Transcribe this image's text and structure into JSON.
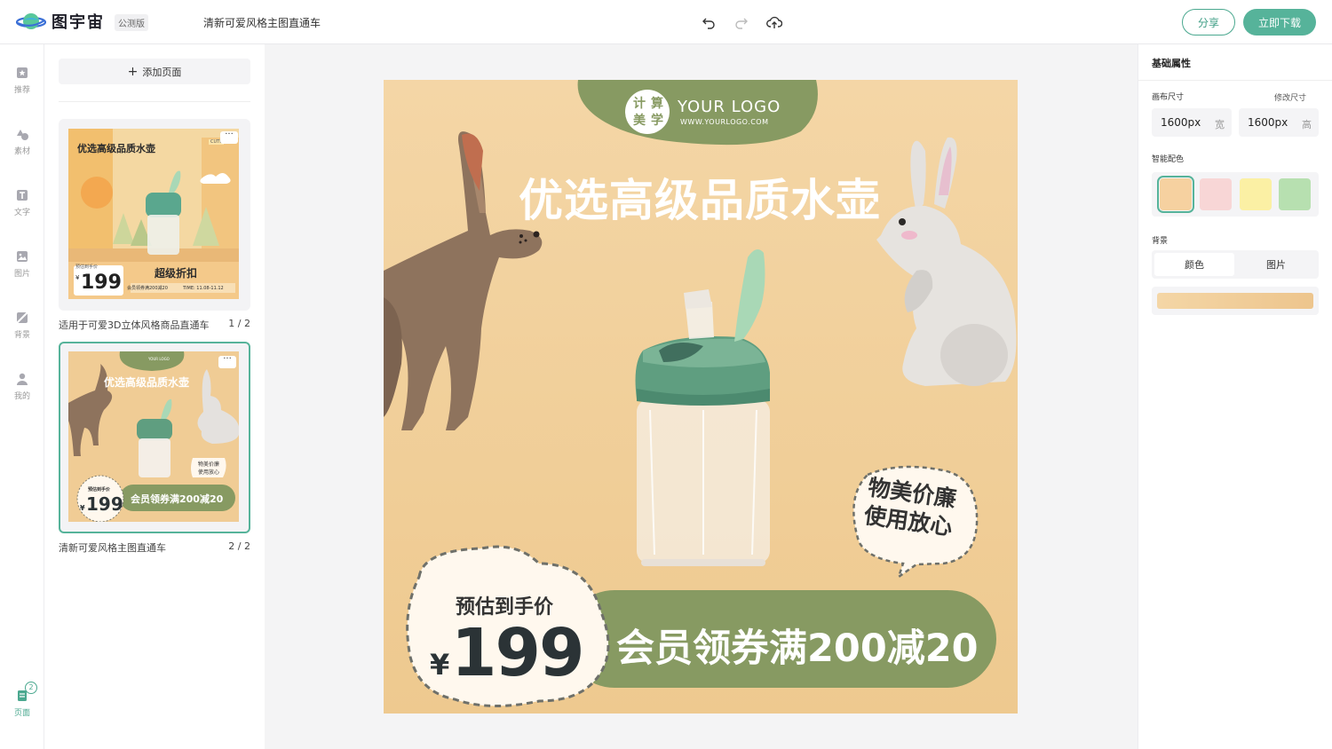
{
  "app": {
    "name": "图宇宙",
    "beta_badge": "公测版"
  },
  "header": {
    "doc_title": "清新可爱风格主图直通车",
    "share_label": "分享",
    "download_label": "立即下载"
  },
  "rail": {
    "items": [
      {
        "label": "推荐",
        "icon": "recommend-icon"
      },
      {
        "label": "素材",
        "icon": "shapes-icon"
      },
      {
        "label": "文字",
        "icon": "text-icon"
      },
      {
        "label": "图片",
        "icon": "image-icon"
      },
      {
        "label": "背景",
        "icon": "background-icon"
      },
      {
        "label": "我的",
        "icon": "user-icon"
      }
    ],
    "pages": {
      "label": "页面",
      "count": "2"
    }
  },
  "pages_panel": {
    "add_page_label": "添加页面",
    "pages": [
      {
        "caption": "适用于可爱3D立体风格商品直通车",
        "index": "1 / 2",
        "thumb": {
          "title": "优选高级品质水壶",
          "tag": "CUTE",
          "pre_label": "预估到手价",
          "currency": "¥",
          "price": "199",
          "promo": "超级折扣",
          "coupon": "会员领券满200减20",
          "time": "TIME: 11.08-11.12"
        }
      },
      {
        "caption": "清新可爱风格主图直通车",
        "index": "2 / 2",
        "thumb": {
          "logo": "YOUR LOGO",
          "title": "优选高级品质水壶",
          "bubble_1": "物美价廉",
          "bubble_2": "使用放心",
          "pre_label": "预估到手价",
          "currency": "¥",
          "price": "199",
          "coupon": "会员领券满200减20"
        }
      }
    ]
  },
  "canvas": {
    "logo_chars": [
      "计",
      "算",
      "美",
      "学"
    ],
    "logo_text": "YOUR LOGO",
    "logo_url": "WWW.YOURLOGO.COM",
    "headline": "优选高级品质水壶",
    "bubble_line1": "物美价廉",
    "bubble_line2": "使用放心",
    "price_label": "预估到手价",
    "currency": "¥",
    "price": "199",
    "coupon": "会员领券满200减20",
    "colors": {
      "bg_top": "#f4d6a6",
      "bg_bottom": "#eec98f",
      "green": "#879a62",
      "hare": "#8e735d",
      "rabbit": "#e4e1de"
    }
  },
  "props": {
    "heading": "基础属性",
    "canvas_size_label": "画布尺寸",
    "change_size_label": "修改尺寸",
    "width_value": "1600px",
    "width_unit": "宽",
    "height_value": "1600px",
    "height_unit": "高",
    "smart_color_label": "智能配色",
    "swatches": [
      "#f6d1a0",
      "#f8d6d6",
      "#fbf0a4",
      "#b7e0b0"
    ],
    "background_label": "背景",
    "bg_tabs": [
      "颜色",
      "图片"
    ]
  }
}
